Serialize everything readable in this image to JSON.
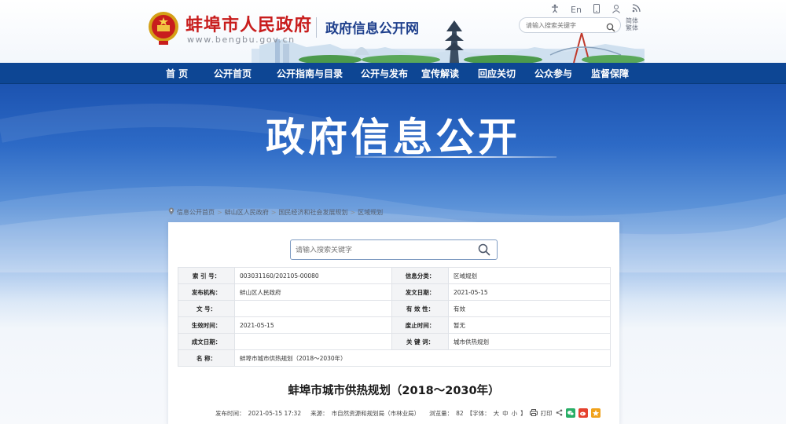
{
  "header": {
    "site_name": "蚌埠市人民政府",
    "site_domain": "www.bengbu.gov.cn",
    "site_subtitle": "政府信息公开网",
    "language_link": "En",
    "search_placeholder": "请输入搜索关键字",
    "skin_link": "简体 繁体",
    "icons": [
      "accessibility-icon",
      "language-icon",
      "mobile-icon",
      "user-icon",
      "rss-icon"
    ]
  },
  "nav": {
    "items": [
      "首 页",
      "公开首页",
      "公开指南与目录",
      "公开与发布",
      "宣传解读",
      "回应关切",
      "公众参与",
      "监督保障"
    ]
  },
  "banner": {
    "title": "政府信息公开"
  },
  "breadcrumb": {
    "items": [
      "信息公开首页",
      "蚌山区人民政府",
      "国民经济和社会发展规划",
      "区域规划"
    ]
  },
  "search": {
    "placeholder": "请输入搜索关键字"
  },
  "meta": {
    "rows": [
      [
        {
          "label": "索 引 号：",
          "value": "003031160/202105-00080"
        },
        {
          "label": "信息分类：",
          "value": "区域规划"
        }
      ],
      [
        {
          "label": "发布机构：",
          "value": "蚌山区人民政府"
        },
        {
          "label": "发文日期：",
          "value": "2021-05-15"
        }
      ],
      [
        {
          "label": "文 号：",
          "value": ""
        },
        {
          "label": "有 效 性：",
          "value": "有效"
        }
      ],
      [
        {
          "label": "生效时间：",
          "value": "2021-05-15"
        },
        {
          "label": "废止时间：",
          "value": "暂无"
        }
      ],
      [
        {
          "label": "成文日期：",
          "value": ""
        },
        {
          "label": "关 键 词：",
          "value": "城市供热规划"
        }
      ]
    ],
    "name_label": "名 称：",
    "name_value": "蚌埠市城市供热规划（2018～2030年）"
  },
  "document": {
    "title": "蚌埠市城市供热规划（2018～2030年）",
    "publish_time_label": "发布时间：",
    "publish_time": "2021-05-15 17:32",
    "source_label": "来源：",
    "source": "市自然资源和规划局（市林业局）",
    "views_label": "浏览量：",
    "views": "82",
    "font_label": "【字体：",
    "font_sizes": [
      "大",
      "中",
      "小"
    ],
    "font_close": "】",
    "print_label": "打印"
  },
  "colors": {
    "nav_bg": "#0d4694",
    "site_name": "#c81d1d",
    "subtitle": "#1e3f8c",
    "banner_top": "#1c53b0"
  }
}
